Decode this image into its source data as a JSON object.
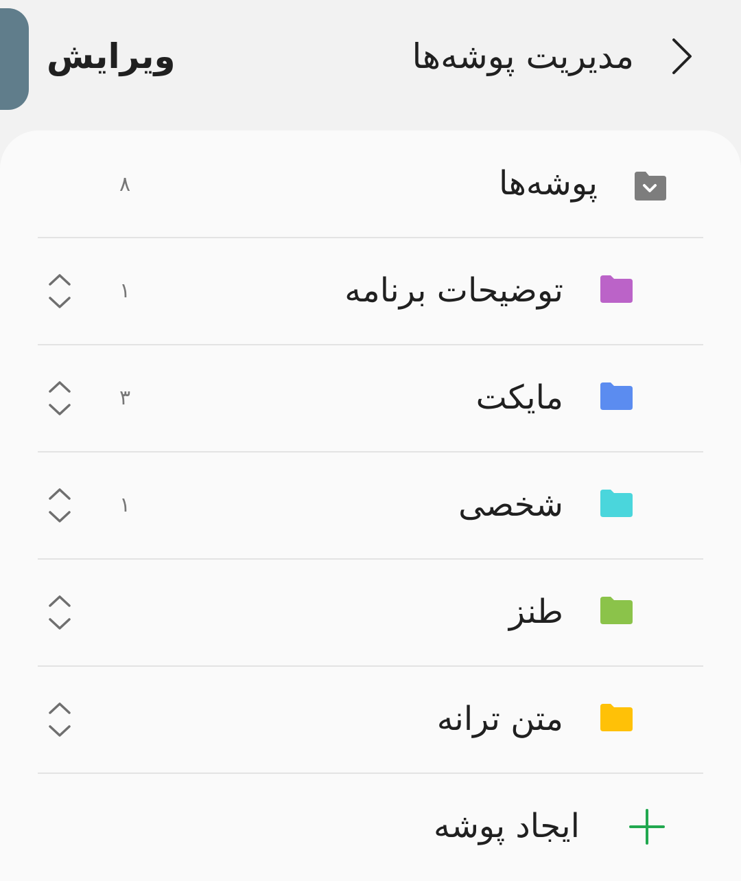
{
  "header": {
    "title": "مدیریت پوشه‌ها",
    "edit_label": "ویرایش",
    "back_icon": "chevron-right-icon"
  },
  "all_folders": {
    "label": "پوشه‌ها",
    "count": "۸",
    "icon": "folder-collapse-icon",
    "icon_color": "#7d7d7d"
  },
  "folders": [
    {
      "label": "توضیحات برنامه",
      "count": "۱",
      "color": "#bb63c8"
    },
    {
      "label": "مایکت",
      "count": "۳",
      "color": "#5b8cf0"
    },
    {
      "label": "شخصی",
      "count": "۱",
      "color": "#4ad6dc"
    },
    {
      "label": "طنز",
      "count": "",
      "color": "#8bc34a"
    },
    {
      "label": "متن ترانه",
      "count": "",
      "color": "#ffc107"
    }
  ],
  "add_folder": {
    "label": "ایجاد پوشه",
    "icon": "plus-icon",
    "color": "#21a84f"
  },
  "colors": {
    "side_tab": "#607d8b",
    "background": "#f2f2f2",
    "card": "#fafafa"
  }
}
